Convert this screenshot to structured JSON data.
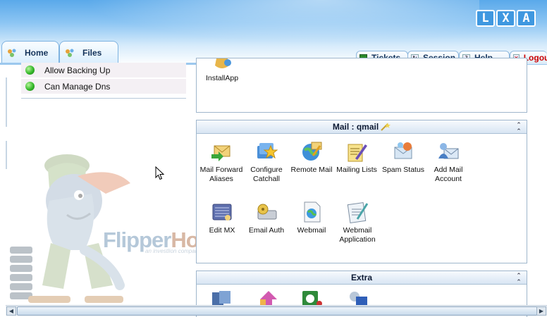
{
  "header": {
    "logo_letters": [
      "L",
      "X",
      "A"
    ]
  },
  "left_tabs": [
    {
      "label": "Home"
    },
    {
      "label": "Files"
    }
  ],
  "right_tabs": [
    {
      "label": "Tickets"
    },
    {
      "label": "Session"
    },
    {
      "label": "Help"
    },
    {
      "label": "Logout"
    }
  ],
  "permissions": [
    {
      "label": "Allow Backing Up"
    },
    {
      "label": "Can Manage Dns"
    }
  ],
  "top_panel": {
    "items": [
      {
        "label": "InstallApp",
        "icon": "install-app-icon"
      }
    ]
  },
  "mail_panel": {
    "title": "Mail : qmail",
    "items": [
      {
        "label": "Mail Forward Aliases",
        "icon": "mail-forward-icon"
      },
      {
        "label": "Configure Catchall",
        "icon": "catchall-icon"
      },
      {
        "label": "Remote Mail",
        "icon": "remote-mail-icon"
      },
      {
        "label": "Mailing Lists",
        "icon": "mailing-lists-icon"
      },
      {
        "label": "Spam Status",
        "icon": "spam-status-icon"
      },
      {
        "label": "Add Mail Account",
        "icon": "add-mail-account-icon"
      },
      {
        "label": "Edit MX",
        "icon": "edit-mx-icon"
      },
      {
        "label": "Email Auth",
        "icon": "email-auth-icon"
      },
      {
        "label": "Webmail",
        "icon": "webmail-icon"
      },
      {
        "label": "Webmail Application",
        "icon": "webmail-application-icon"
      }
    ]
  },
  "extra_panel": {
    "title": "Extra"
  },
  "branding": {
    "name_part1": "Flipper",
    "name_part2": "Host",
    "tagline": "an investlion company"
  },
  "colors": {
    "accent_blue": "#3f98e0",
    "logout_red": "#cc0000",
    "status_green": "#35b82a",
    "panel_border": "#9fb6cc"
  }
}
